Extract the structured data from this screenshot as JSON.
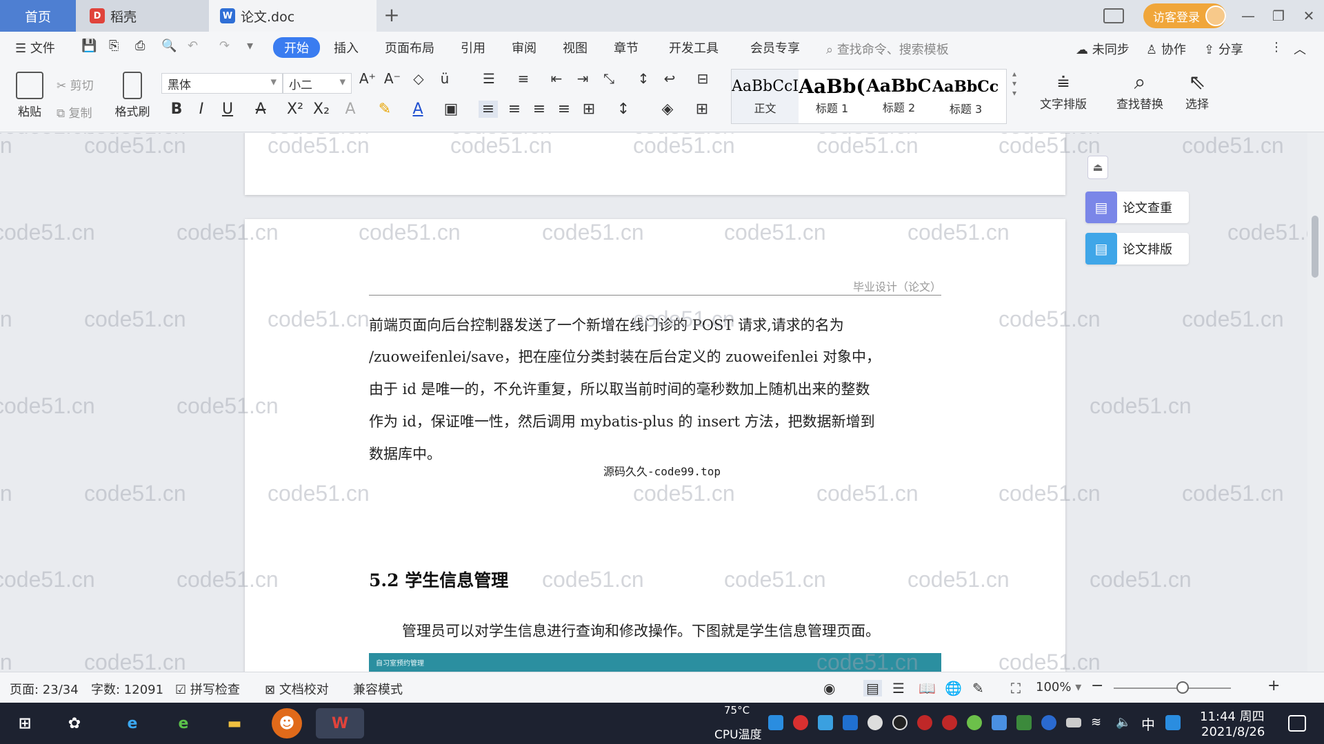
{
  "tabs": {
    "home": "首页",
    "docer": "稻壳",
    "document": "论文.doc"
  },
  "titlebar": {
    "login_label": "访客登录"
  },
  "menu": {
    "file": "文件",
    "items": [
      "开始",
      "插入",
      "页面布局",
      "引用",
      "审阅",
      "视图",
      "章节",
      "开发工具",
      "会员专享"
    ],
    "search_placeholder": "查找命令、搜索模板",
    "sync": "未同步",
    "collaborate": "协作",
    "share": "分享"
  },
  "ribbon": {
    "paste": "粘贴",
    "cut": "剪切",
    "copy": "复制",
    "format_painter": "格式刷",
    "font_name": "黑体",
    "font_size": "小二",
    "styles": [
      {
        "sample": "AaBbCcI",
        "name": "正文"
      },
      {
        "sample": "AaBb(",
        "name": "标题 1"
      },
      {
        "sample": "AaBbC",
        "name": "标题 2"
      },
      {
        "sample": "AaBbCcl",
        "name": "标题 3"
      }
    ],
    "text_layout": "文字排版",
    "find_replace": "查找替换",
    "select": "选择"
  },
  "document": {
    "header": "毕业设计（论文）",
    "para_lines": [
      "前端页面向后台控制器发送了一个新增在线门诊的 POST 请求,请求的名为",
      "/zuoweifenlei/save，把在座位分类封装在后台定义的 zuoweifenlei 对象中，",
      "由于 id 是唯一的，不允许重复，所以取当前时间的毫秒数加上随机出来的整数",
      "作为 id，保证唯一性，然后调用 mybatis-plus 的 insert 方法，把数据新增到",
      "数据库中。"
    ],
    "overlay": "源码久久-code99.top",
    "heading": "5.2 学生信息管理",
    "intro": "管理员可以对学生信息进行查询和修改操作。下图就是学生信息管理页面。",
    "image_caption": "自习室预约管理",
    "watermark": "code51.cn"
  },
  "side_panel": {
    "check": "论文查重",
    "format": "论文排版"
  },
  "status": {
    "page": "页面: 23/34",
    "words": "字数: 12091",
    "spell": "拼写检查",
    "proof": "文档校对",
    "compat": "兼容模式",
    "zoom": "100%"
  },
  "taskbar": {
    "cpu_temp": "75°C",
    "cpu_label": "CPU温度",
    "ime": "中",
    "time": "11:44 周四",
    "date": "2021/8/26"
  }
}
